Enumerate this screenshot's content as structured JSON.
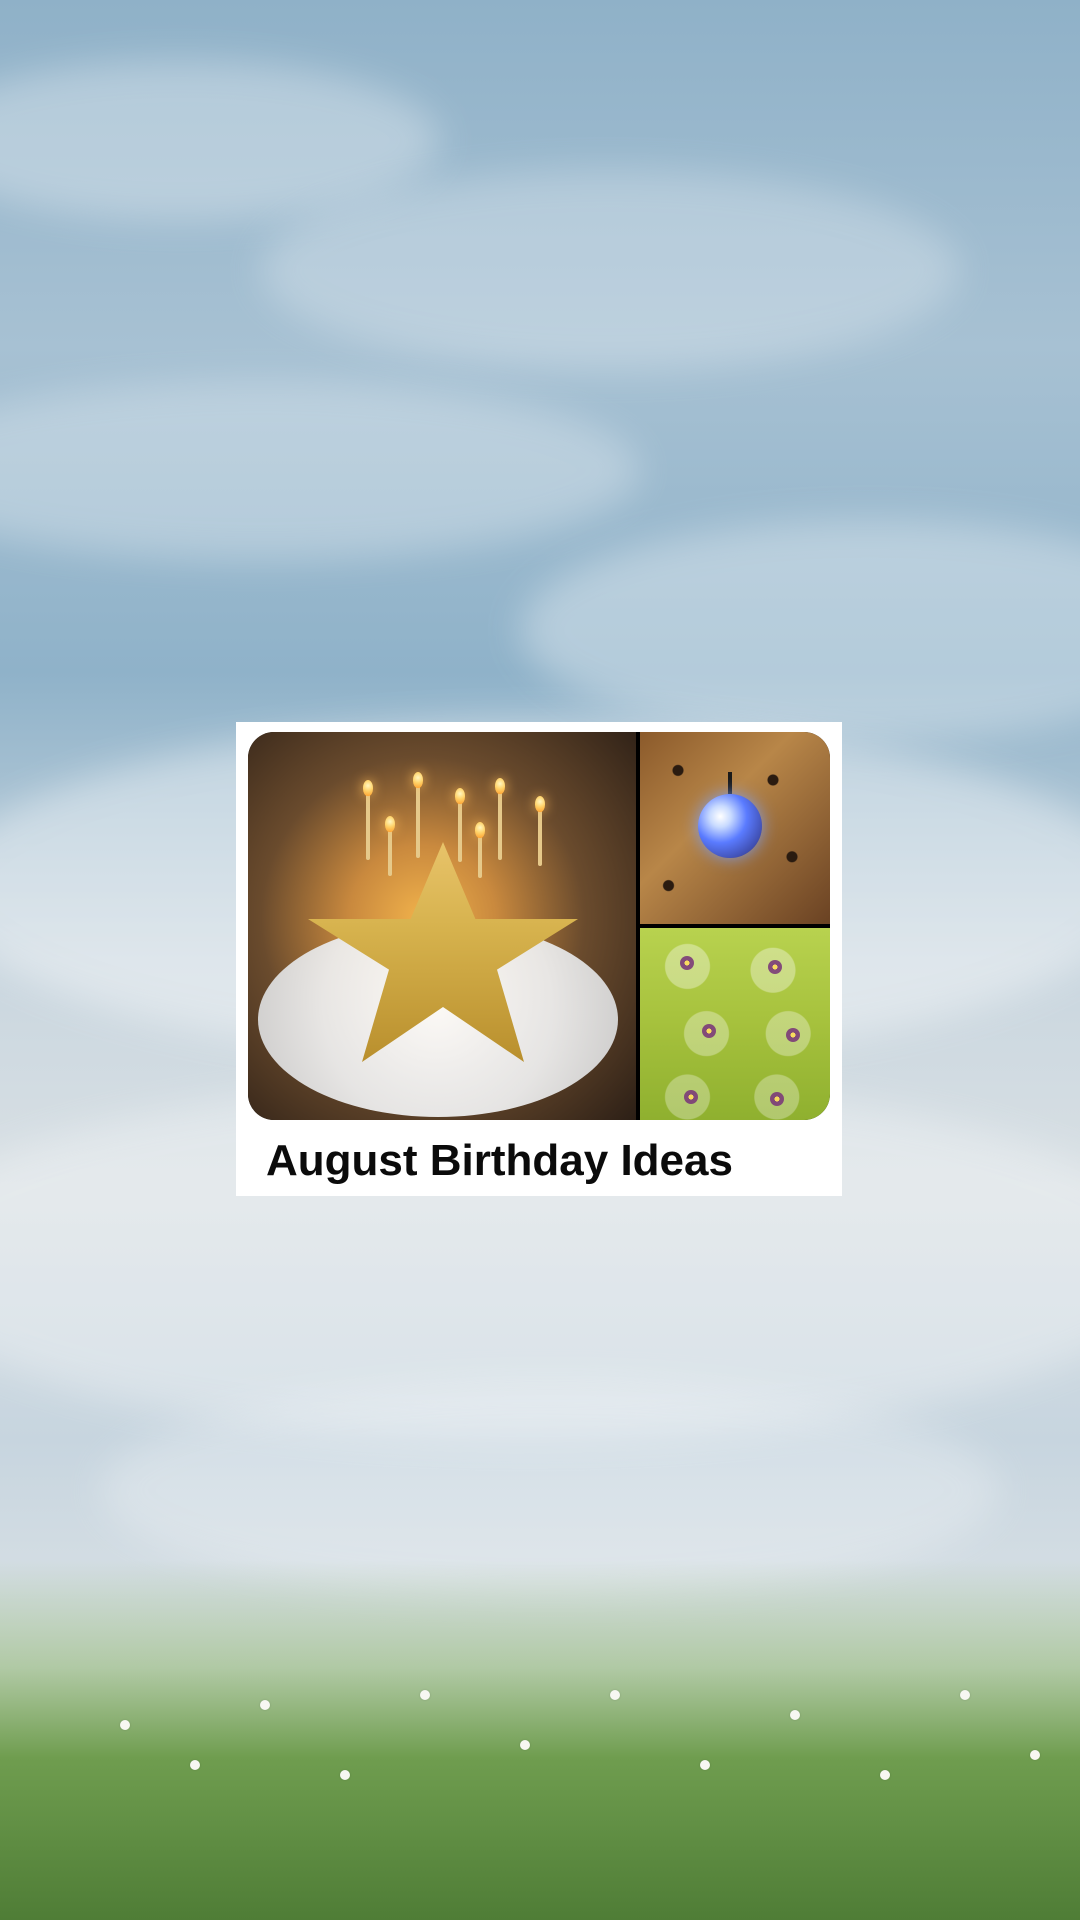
{
  "board": {
    "title": "August Birthday Ideas",
    "images": [
      {
        "icon": "birthday-cake-image"
      },
      {
        "icon": "disco-ball-image"
      },
      {
        "icon": "green-jello-cups-image"
      }
    ]
  },
  "colors": {
    "card_bg": "#ffffff",
    "title_text": "#0b0b0b"
  }
}
